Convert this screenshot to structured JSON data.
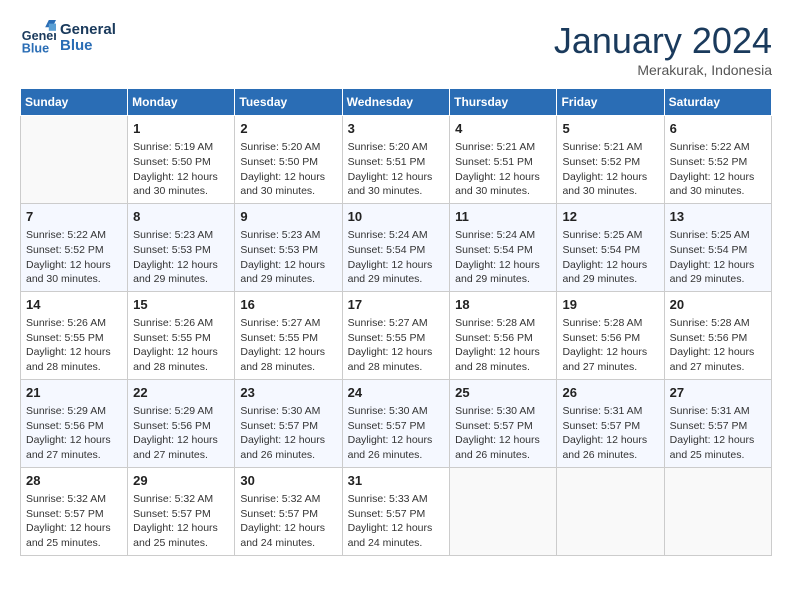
{
  "header": {
    "logo_line1": "General",
    "logo_line2": "Blue",
    "month_title": "January 2024",
    "subtitle": "Merakurak, Indonesia"
  },
  "days_of_week": [
    "Sunday",
    "Monday",
    "Tuesday",
    "Wednesday",
    "Thursday",
    "Friday",
    "Saturday"
  ],
  "weeks": [
    [
      {
        "day": "",
        "info": ""
      },
      {
        "day": "1",
        "info": "Sunrise: 5:19 AM\nSunset: 5:50 PM\nDaylight: 12 hours\nand 30 minutes."
      },
      {
        "day": "2",
        "info": "Sunrise: 5:20 AM\nSunset: 5:50 PM\nDaylight: 12 hours\nand 30 minutes."
      },
      {
        "day": "3",
        "info": "Sunrise: 5:20 AM\nSunset: 5:51 PM\nDaylight: 12 hours\nand 30 minutes."
      },
      {
        "day": "4",
        "info": "Sunrise: 5:21 AM\nSunset: 5:51 PM\nDaylight: 12 hours\nand 30 minutes."
      },
      {
        "day": "5",
        "info": "Sunrise: 5:21 AM\nSunset: 5:52 PM\nDaylight: 12 hours\nand 30 minutes."
      },
      {
        "day": "6",
        "info": "Sunrise: 5:22 AM\nSunset: 5:52 PM\nDaylight: 12 hours\nand 30 minutes."
      }
    ],
    [
      {
        "day": "7",
        "info": "Sunrise: 5:22 AM\nSunset: 5:52 PM\nDaylight: 12 hours\nand 30 minutes."
      },
      {
        "day": "8",
        "info": "Sunrise: 5:23 AM\nSunset: 5:53 PM\nDaylight: 12 hours\nand 29 minutes."
      },
      {
        "day": "9",
        "info": "Sunrise: 5:23 AM\nSunset: 5:53 PM\nDaylight: 12 hours\nand 29 minutes."
      },
      {
        "day": "10",
        "info": "Sunrise: 5:24 AM\nSunset: 5:54 PM\nDaylight: 12 hours\nand 29 minutes."
      },
      {
        "day": "11",
        "info": "Sunrise: 5:24 AM\nSunset: 5:54 PM\nDaylight: 12 hours\nand 29 minutes."
      },
      {
        "day": "12",
        "info": "Sunrise: 5:25 AM\nSunset: 5:54 PM\nDaylight: 12 hours\nand 29 minutes."
      },
      {
        "day": "13",
        "info": "Sunrise: 5:25 AM\nSunset: 5:54 PM\nDaylight: 12 hours\nand 29 minutes."
      }
    ],
    [
      {
        "day": "14",
        "info": "Sunrise: 5:26 AM\nSunset: 5:55 PM\nDaylight: 12 hours\nand 28 minutes."
      },
      {
        "day": "15",
        "info": "Sunrise: 5:26 AM\nSunset: 5:55 PM\nDaylight: 12 hours\nand 28 minutes."
      },
      {
        "day": "16",
        "info": "Sunrise: 5:27 AM\nSunset: 5:55 PM\nDaylight: 12 hours\nand 28 minutes."
      },
      {
        "day": "17",
        "info": "Sunrise: 5:27 AM\nSunset: 5:55 PM\nDaylight: 12 hours\nand 28 minutes."
      },
      {
        "day": "18",
        "info": "Sunrise: 5:28 AM\nSunset: 5:56 PM\nDaylight: 12 hours\nand 28 minutes."
      },
      {
        "day": "19",
        "info": "Sunrise: 5:28 AM\nSunset: 5:56 PM\nDaylight: 12 hours\nand 27 minutes."
      },
      {
        "day": "20",
        "info": "Sunrise: 5:28 AM\nSunset: 5:56 PM\nDaylight: 12 hours\nand 27 minutes."
      }
    ],
    [
      {
        "day": "21",
        "info": "Sunrise: 5:29 AM\nSunset: 5:56 PM\nDaylight: 12 hours\nand 27 minutes."
      },
      {
        "day": "22",
        "info": "Sunrise: 5:29 AM\nSunset: 5:56 PM\nDaylight: 12 hours\nand 27 minutes."
      },
      {
        "day": "23",
        "info": "Sunrise: 5:30 AM\nSunset: 5:57 PM\nDaylight: 12 hours\nand 26 minutes."
      },
      {
        "day": "24",
        "info": "Sunrise: 5:30 AM\nSunset: 5:57 PM\nDaylight: 12 hours\nand 26 minutes."
      },
      {
        "day": "25",
        "info": "Sunrise: 5:30 AM\nSunset: 5:57 PM\nDaylight: 12 hours\nand 26 minutes."
      },
      {
        "day": "26",
        "info": "Sunrise: 5:31 AM\nSunset: 5:57 PM\nDaylight: 12 hours\nand 26 minutes."
      },
      {
        "day": "27",
        "info": "Sunrise: 5:31 AM\nSunset: 5:57 PM\nDaylight: 12 hours\nand 25 minutes."
      }
    ],
    [
      {
        "day": "28",
        "info": "Sunrise: 5:32 AM\nSunset: 5:57 PM\nDaylight: 12 hours\nand 25 minutes."
      },
      {
        "day": "29",
        "info": "Sunrise: 5:32 AM\nSunset: 5:57 PM\nDaylight: 12 hours\nand 25 minutes."
      },
      {
        "day": "30",
        "info": "Sunrise: 5:32 AM\nSunset: 5:57 PM\nDaylight: 12 hours\nand 24 minutes."
      },
      {
        "day": "31",
        "info": "Sunrise: 5:33 AM\nSunset: 5:57 PM\nDaylight: 12 hours\nand 24 minutes."
      },
      {
        "day": "",
        "info": ""
      },
      {
        "day": "",
        "info": ""
      },
      {
        "day": "",
        "info": ""
      }
    ]
  ]
}
